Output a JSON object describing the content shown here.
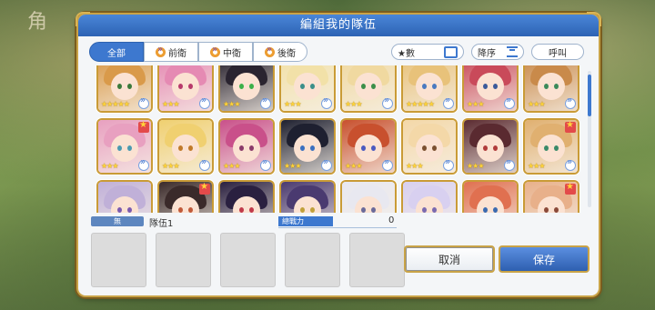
{
  "dialog": {
    "title": "編組我的隊伍"
  },
  "background": {
    "title_fragment": "角"
  },
  "filters": {
    "tabs": [
      {
        "label": "全部",
        "active": true
      },
      {
        "label": "前衛",
        "active": false
      },
      {
        "label": "中衛",
        "active": false
      },
      {
        "label": "後衛",
        "active": false
      }
    ]
  },
  "sort": {
    "key_label": "★數",
    "order_label": "降序",
    "call_label": "呼叫"
  },
  "team": {
    "tag": "無",
    "name": "隊伍1",
    "power_label": "總戰力",
    "power_value": "0"
  },
  "buttons": {
    "cancel": "取消",
    "save": "保存"
  },
  "character_grid": {
    "rows": [
      [
        {
          "stars": "★★★★★",
          "badge": false,
          "hair": "#d99a4a",
          "eyes": "#3b7a3b"
        },
        {
          "stars": "★★★",
          "badge": false,
          "hair": "#e58ab3",
          "eyes": "#b83a6b"
        },
        {
          "stars": "★★★",
          "badge": false,
          "hair": "#2a2430",
          "eyes": "#3bb04a"
        },
        {
          "stars": "★★★",
          "badge": false,
          "hair": "#f2e1a8",
          "eyes": "#3b8f8a"
        },
        {
          "stars": "★★★",
          "badge": false,
          "hair": "#f0d9a0",
          "eyes": "#3b8f4a"
        },
        {
          "stars": "★★★★★",
          "badge": false,
          "hair": "#e8c27a",
          "eyes": "#4a7ac0"
        },
        {
          "stars": "★★★",
          "badge": false,
          "hair": "#c94a5a",
          "eyes": "#3a5a9a"
        },
        {
          "stars": "★★★",
          "badge": false,
          "hair": "#c98a4a",
          "eyes": "#3b8a5a"
        }
      ],
      [
        {
          "stars": "★★★",
          "badge": true,
          "hair": "#e8a0c0",
          "eyes": "#4a9ab0"
        },
        {
          "stars": "★★★",
          "badge": false,
          "hair": "#f0d070",
          "eyes": "#c07a2a"
        },
        {
          "stars": "★★★",
          "badge": false,
          "hair": "#c9508a",
          "eyes": "#8a3a6a"
        },
        {
          "stars": "★★★",
          "badge": false,
          "hair": "#1e2030",
          "eyes": "#3a70c0"
        },
        {
          "stars": "★★★",
          "badge": false,
          "hair": "#c8502e",
          "eyes": "#4a5ac0"
        },
        {
          "stars": "★★★",
          "badge": false,
          "hair": "#f4d8a8",
          "eyes": "#7a5030"
        },
        {
          "stars": "★★★",
          "badge": false,
          "hair": "#5a2a30",
          "eyes": "#b03a3a"
        },
        {
          "stars": "★★★",
          "badge": true,
          "hair": "#e0b070",
          "eyes": "#3a8a6a"
        }
      ],
      [
        {
          "stars": "",
          "badge": false,
          "hair": "#c0b0d8",
          "eyes": "#7a5ab0"
        },
        {
          "stars": "",
          "badge": true,
          "hair": "#3a2a2a",
          "eyes": "#c05a3a"
        },
        {
          "stars": "",
          "badge": false,
          "hair": "#2a2040",
          "eyes": "#c03a4a"
        },
        {
          "stars": "",
          "badge": false,
          "hair": "#4a3a70",
          "eyes": "#c0a03a"
        },
        {
          "stars": "",
          "badge": false,
          "hair": "#e8e8f0",
          "eyes": "#6a6a9a"
        },
        {
          "stars": "",
          "badge": false,
          "hair": "#d8d0f0",
          "eyes": "#7a6ab0"
        },
        {
          "stars": "",
          "badge": false,
          "hair": "#e07050",
          "eyes": "#3a6ab0"
        },
        {
          "stars": "",
          "badge": true,
          "hair": "#e8b08a",
          "eyes": "#8a4a3a"
        }
      ]
    ]
  },
  "team_slots": 5
}
